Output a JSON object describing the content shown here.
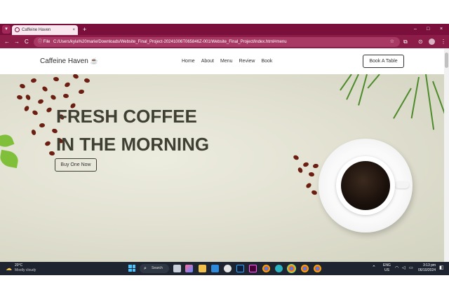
{
  "browser": {
    "tab_title": "Caffeine Haven",
    "tab_close": "×",
    "new_tab": "+",
    "window_controls": [
      "–",
      "□",
      "×"
    ],
    "omnibox_info": "ⓘ File",
    "url": "C:/Users/kyla%20marie/Downloads/Website_Final_Project-20241006T065846Z-001/Website_Final_Project/index.html#menu",
    "nav": {
      "back": "←",
      "forward": "→",
      "reload": "C"
    },
    "accent_color": "#7a0f3b"
  },
  "site": {
    "logo": "Caffeine Haven",
    "logo_icon": "coffee-cup-icon",
    "nav": [
      "Home",
      "About",
      "Menu",
      "Review",
      "Book"
    ],
    "book_button": "Book A Table",
    "hero": {
      "title_line1": "FRESH COFFEE",
      "title_line2": "IN THE MORNING",
      "cta": "Buy One Now"
    }
  },
  "taskbar": {
    "weather_temp": "20°C",
    "weather_desc": "Mostly cloudy",
    "search_label": "Search",
    "lang_line1": "ENG",
    "lang_line2": "US",
    "time": "3:13 pm",
    "date": "06/10/2024"
  }
}
